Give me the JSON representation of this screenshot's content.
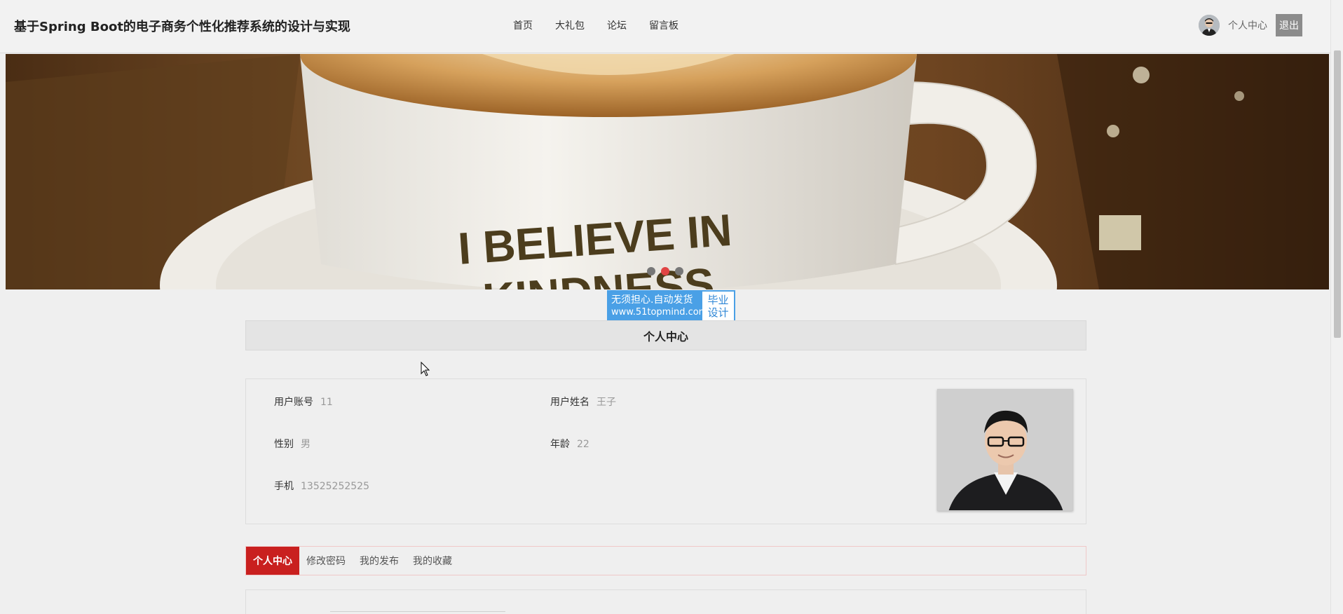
{
  "header": {
    "site_title": "基于Spring Boot的电子商务个性化推荐系统的设计与实现",
    "nav": [
      "首页",
      "大礼包",
      "论坛",
      "留言板"
    ],
    "user_center": "个人中心",
    "logout": "退出"
  },
  "banner": {
    "cup_text_1": "I BELIEVE IN",
    "cup_text_2": "KINDNESS.",
    "slide_count": 3,
    "active_slide": 2
  },
  "watermark": {
    "line1": "无须担心.自动发货",
    "line2": "www.51topmind.com",
    "right_top": "毕业",
    "right_bottom": "设计"
  },
  "section_title": "个人中心",
  "profile": {
    "account_label": "用户账号",
    "account_value": "11",
    "name_label": "用户姓名",
    "name_value": "王子",
    "gender_label": "性别",
    "gender_value": "男",
    "age_label": "年龄",
    "age_value": "22",
    "phone_label": "手机",
    "phone_value": "13525252525"
  },
  "tabs": [
    "个人中心",
    "修改密码",
    "我的发布",
    "我的收藏"
  ],
  "active_tab": 0,
  "colors": {
    "accent": "#c9201f",
    "active_dot": "#e04444",
    "badge": "#4aa0e6"
  }
}
